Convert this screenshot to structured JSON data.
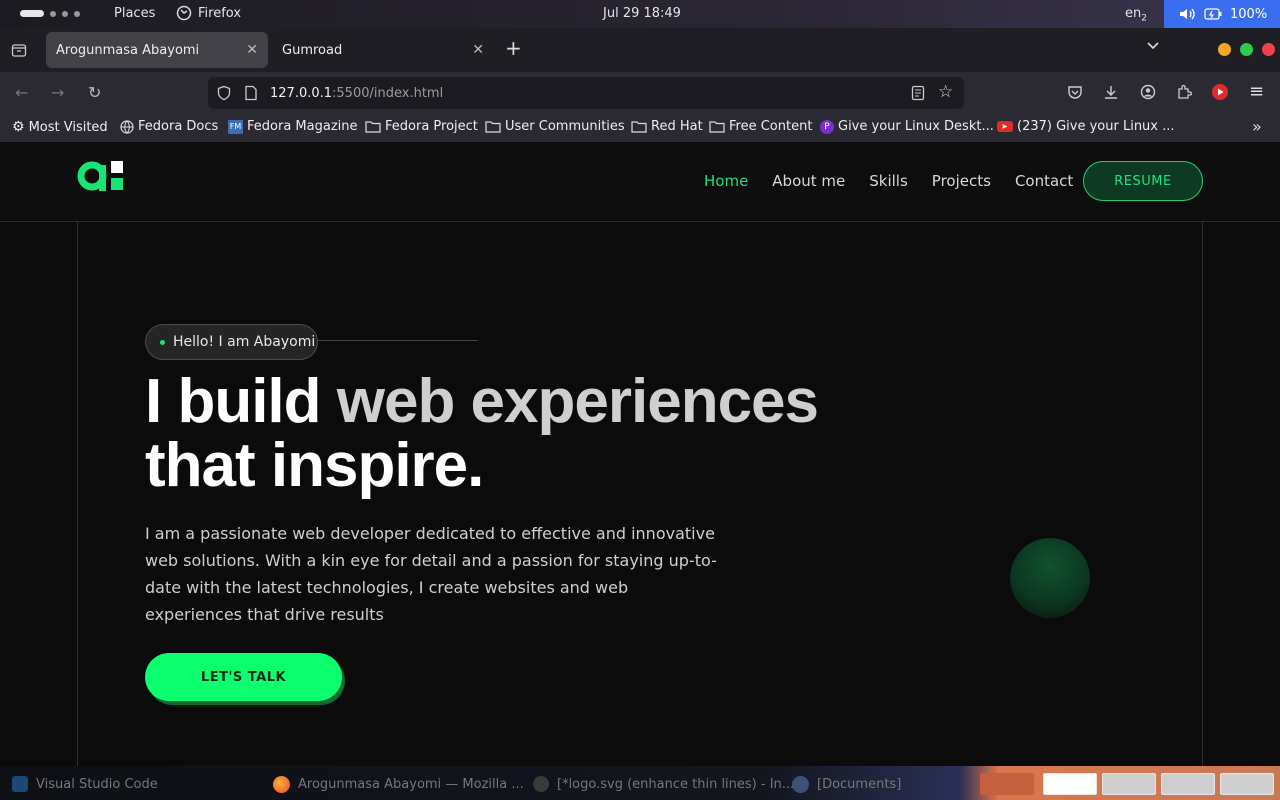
{
  "system": {
    "places": "Places",
    "firefox": "Firefox",
    "clock": "Jul 29  18:49",
    "lang": "en",
    "lang_sub": "2",
    "battery": "100%"
  },
  "browser": {
    "tabs": [
      {
        "title": "Arogunmasa Abayomi"
      },
      {
        "title": "Gumroad"
      }
    ],
    "url_host": "127.0.0.1",
    "url_path": ":5500/index.html",
    "bookmarks": [
      {
        "label": "Most Visited",
        "icon": "gear-icon"
      },
      {
        "label": "Fedora Docs",
        "icon": "globe-icon"
      },
      {
        "label": "Fedora Magazine",
        "icon": "fm-icon"
      },
      {
        "label": "Fedora Project",
        "icon": "folder-icon"
      },
      {
        "label": "User Communities",
        "icon": "folder-icon"
      },
      {
        "label": "Red Hat",
        "icon": "folder-icon"
      },
      {
        "label": "Free Content",
        "icon": "folder-icon"
      },
      {
        "label": "Give your Linux Deskt...",
        "icon": "purple-p-icon"
      },
      {
        "label": "(237) Give your Linux ...",
        "icon": "youtube-icon"
      }
    ]
  },
  "site": {
    "nav": {
      "home": "Home",
      "about": "About me",
      "skills": "Skills",
      "projects": "Projects",
      "contact": "Contact",
      "resume": "RESUME"
    },
    "hero": {
      "hello": "Hello! I am Abayomi",
      "line1_a": "I build ",
      "line1_b": "web experiences",
      "line2": "that inspire.",
      "description": "I am a passionate web developer dedicated to effective and innovative web solutions. With a kin eye for detail and a passion for staying up-to-date with the latest technologies, I create websites and web experiences that drive results",
      "cta": "LET'S TALK"
    },
    "colors": {
      "accent": "#22e07a",
      "cta": "#0cff6e"
    }
  },
  "taskbar": {
    "items": [
      {
        "label": "Visual Studio Code",
        "icon": "vscode-icon"
      },
      {
        "label": "Arogunmasa Abayomi — Mozilla ...",
        "icon": "firefox-icon"
      },
      {
        "label": "[*logo.svg (enhance thin lines) - In...",
        "icon": "inkscape-icon"
      },
      {
        "label": "[Documents]",
        "icon": "files-icon"
      }
    ]
  }
}
